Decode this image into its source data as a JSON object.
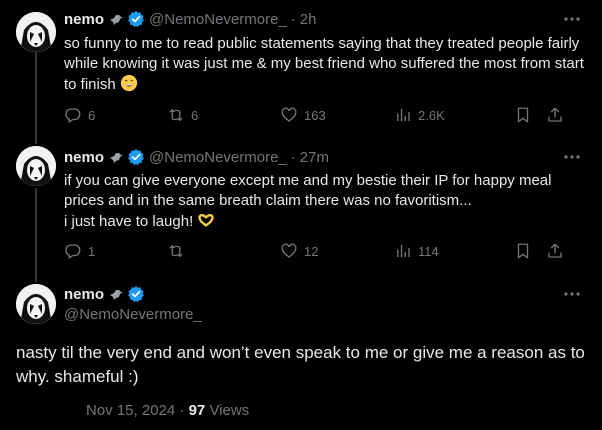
{
  "colors": {
    "background": "#000000",
    "text": "#e7e9ea",
    "muted": "#71767b",
    "verified": "#1d9bf0",
    "thread_line": "#333639"
  },
  "tweets": [
    {
      "name": "nemo",
      "handle": "@NemoNevermore_",
      "separator": "·",
      "time": "2h",
      "text": "so funny to me to read public statements saying that they treated people fairly while knowing it was just me & my best friend who suffered the most from start to finish",
      "emoji": "grinning-face-icon",
      "replies": "6",
      "reposts": "6",
      "likes": "163",
      "views": "2.6K"
    },
    {
      "name": "nemo",
      "handle": "@NemoNevermore_",
      "separator": "·",
      "time": "27m",
      "text_line1": "if you can give everyone except me and my bestie their IP for happy meal prices and in the same breath claim there was no favoritism...",
      "text_line2": "i just have to laugh!",
      "emoji": "heart-hands-icon",
      "replies": "1",
      "reposts": "",
      "likes": "12",
      "views": "114"
    }
  ],
  "main": {
    "name": "nemo",
    "handle": "@NemoNevermore_",
    "text": "nasty til the very end and won’t even speak to me or give me a reason as to why. shameful :)",
    "date": "Nov 15, 2024",
    "separator": "·",
    "views_count": "97",
    "views_label": "Views"
  }
}
